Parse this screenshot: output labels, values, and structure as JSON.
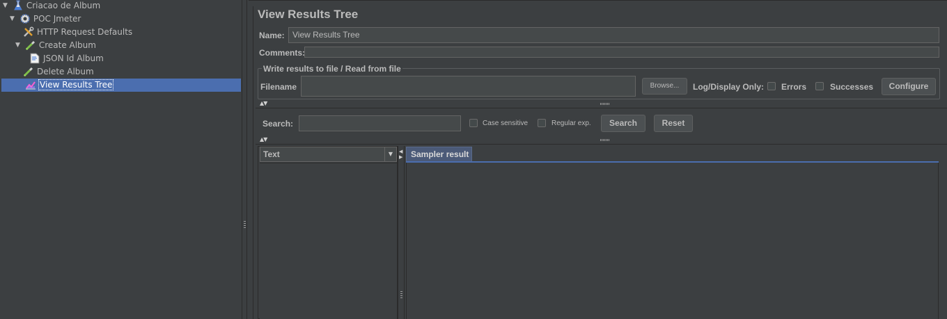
{
  "tree": {
    "items": [
      {
        "label": "Criacao de Album",
        "icon": "flask-icon",
        "toggle": "▼"
      },
      {
        "label": "POC Jmeter",
        "icon": "gear-icon",
        "toggle": "▼"
      },
      {
        "label": "HTTP Request Defaults",
        "icon": "wrench-icon",
        "toggle": ""
      },
      {
        "label": "Create Album",
        "icon": "pipette-icon",
        "toggle": "▼"
      },
      {
        "label": "JSON Id Album",
        "icon": "document-icon",
        "toggle": ""
      },
      {
        "label": "Delete Album",
        "icon": "pipette-icon",
        "toggle": ""
      },
      {
        "label": "View Results Tree",
        "icon": "chart-icon",
        "toggle": ""
      }
    ],
    "selected_index": 6
  },
  "panel": {
    "title": "View Results Tree",
    "name_label": "Name:",
    "name_value": "View Results Tree",
    "comments_label": "Comments:",
    "comments_value": "",
    "file_group_title": "Write results to file / Read from file",
    "filename_label": "Filename",
    "filename_value": "",
    "browse_label": "Browse...",
    "log_display_label": "Log/Display Only:",
    "errors_label": "Errors",
    "successes_label": "Successes",
    "configure_label": "Configure"
  },
  "search": {
    "label": "Search:",
    "value": "",
    "case_sensitive_label": "Case sensitive",
    "regular_exp_label": "Regular exp.",
    "search_button": "Search",
    "reset_button": "Reset"
  },
  "results": {
    "renderer_select": "Text",
    "tab_sampler_result": "Sampler result"
  },
  "colors": {
    "background": "#3c3f41",
    "selection": "#4b6eaf",
    "field": "#45494a",
    "text": "#bbbbbb"
  }
}
